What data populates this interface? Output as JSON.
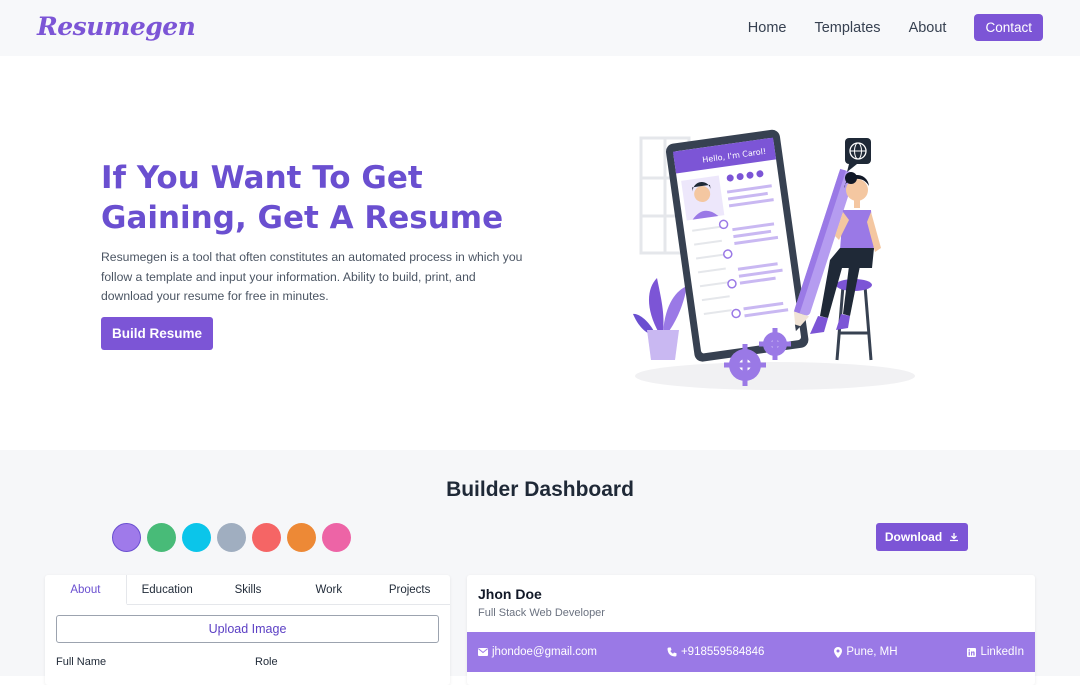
{
  "nav": {
    "logo": "Resumegen",
    "links": [
      "Home",
      "Templates",
      "About"
    ],
    "contact": "Contact"
  },
  "hero": {
    "title_line1": "If You Want To Get",
    "title_line2": "Gaining, Get A Resume",
    "description": "Resumegen is a tool that often constitutes an automated process in which you follow a template and input your information. Ability to build, print, and download your resume for free in minutes.",
    "button": "Build Resume",
    "illustration_text": "Hello, I'm Carol!"
  },
  "dashboard": {
    "title": "Builder Dashboard",
    "swatches": [
      "#9f7aea",
      "#48bb78",
      "#0bc5ea",
      "#a0aec0",
      "#f56565",
      "#ed8936",
      "#ed64a6"
    ],
    "selected_swatch": 0,
    "download": "Download",
    "tabs": [
      "About",
      "Education",
      "Skills",
      "Work",
      "Projects"
    ],
    "active_tab": "About",
    "upload": "Upload Image",
    "field_full_name": "Full Name",
    "field_role": "Role"
  },
  "preview": {
    "name": "Jhon Doe",
    "role": "Full Stack Web Developer",
    "email": "jhondoe@gmail.com",
    "phone": "+918559584846",
    "location": "Pune, MH",
    "linkedin": "LinkedIn",
    "accent": "#9a79e6"
  },
  "colors": {
    "brand": "#7c55d6",
    "title": "#6a4fd0"
  }
}
